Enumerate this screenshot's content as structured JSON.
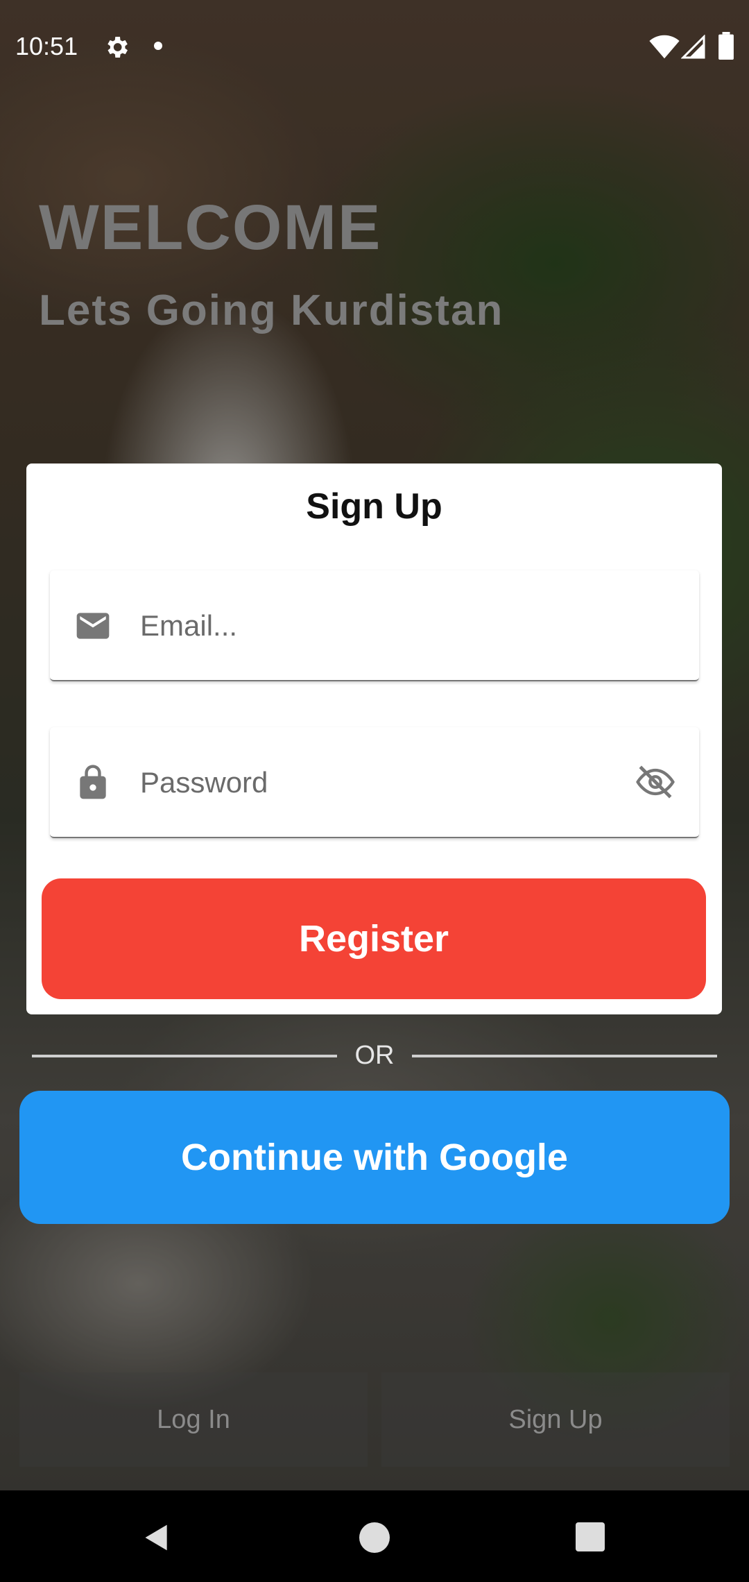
{
  "status_bar": {
    "time": "10:51",
    "icons": [
      "gear-icon",
      "dot-icon",
      "wifi-icon",
      "signal-icon",
      "battery-icon"
    ]
  },
  "header": {
    "title": "WELCOME",
    "subtitle": "Lets Going Kurdistan"
  },
  "card": {
    "title": "Sign Up",
    "email": {
      "placeholder": "Email...",
      "value": "",
      "icon": "email-icon"
    },
    "password": {
      "placeholder": "Password",
      "value": "",
      "icon": "lock-icon",
      "toggle_icon": "eye-off-icon"
    },
    "register_label": "Register"
  },
  "divider": {
    "label": "OR"
  },
  "google": {
    "label": "Continue with Google"
  },
  "tabs": [
    {
      "label": "Log In"
    },
    {
      "label": "Sign Up"
    }
  ],
  "nav": {
    "icons": [
      "back-icon",
      "home-icon",
      "recents-icon"
    ]
  },
  "colors": {
    "register": "#f44336",
    "google": "#2196f3",
    "card": "#ffffff"
  }
}
